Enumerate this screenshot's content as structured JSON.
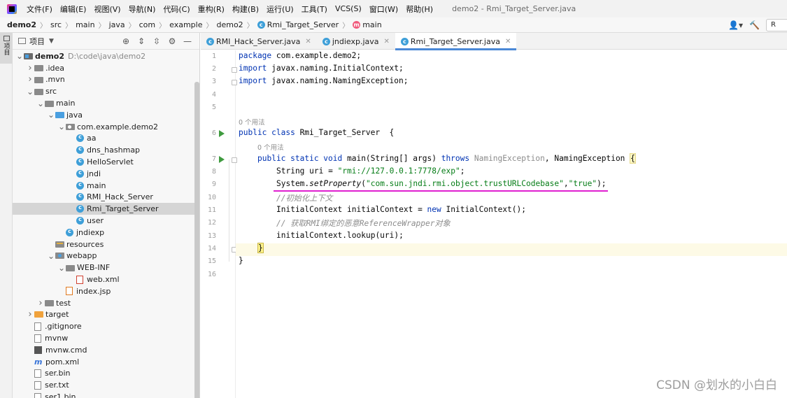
{
  "menu": {
    "items": [
      "文件(F)",
      "编辑(E)",
      "视图(V)",
      "导航(N)",
      "代码(C)",
      "重构(R)",
      "构建(B)",
      "运行(U)",
      "工具(T)",
      "VCS(S)",
      "窗口(W)",
      "帮助(H)"
    ],
    "window_title": "demo2 - Rmi_Target_Server.java"
  },
  "breadcrumb": {
    "items": [
      "demo2",
      "src",
      "main",
      "java",
      "com",
      "example",
      "demo2",
      "Rmi_Target_Server",
      "main"
    ],
    "run_config": "R"
  },
  "left_strip": {
    "label": "项目"
  },
  "project_panel": {
    "title": "项目",
    "tree": [
      {
        "label": "demo2",
        "extra": "D:\\code\\java\\demo2",
        "depth": 0,
        "arrow": "open",
        "icon": "module",
        "bold": true
      },
      {
        "label": ".idea",
        "depth": 1,
        "arrow": "closed",
        "icon": "folder"
      },
      {
        "label": ".mvn",
        "depth": 1,
        "arrow": "closed",
        "icon": "folder"
      },
      {
        "label": "src",
        "depth": 1,
        "arrow": "open",
        "icon": "folder"
      },
      {
        "label": "main",
        "depth": 2,
        "arrow": "open",
        "icon": "folder"
      },
      {
        "label": "java",
        "depth": 3,
        "arrow": "open",
        "icon": "folder-blue"
      },
      {
        "label": "com.example.demo2",
        "depth": 4,
        "arrow": "open",
        "icon": "folder-pkg"
      },
      {
        "label": "aa",
        "depth": 5,
        "arrow": "none",
        "icon": "javacls"
      },
      {
        "label": "dns_hashmap",
        "depth": 5,
        "arrow": "none",
        "icon": "javacls"
      },
      {
        "label": "HelloServlet",
        "depth": 5,
        "arrow": "none",
        "icon": "javacls"
      },
      {
        "label": "jndi",
        "depth": 5,
        "arrow": "none",
        "icon": "javacls"
      },
      {
        "label": "main",
        "depth": 5,
        "arrow": "none",
        "icon": "javacls"
      },
      {
        "label": "RMI_Hack_Server",
        "depth": 5,
        "arrow": "none",
        "icon": "javacls"
      },
      {
        "label": "Rmi_Target_Server",
        "depth": 5,
        "arrow": "none",
        "icon": "javacls",
        "selected": true
      },
      {
        "label": "user",
        "depth": 5,
        "arrow": "none",
        "icon": "javacls"
      },
      {
        "label": "jndiexp",
        "depth": 4,
        "arrow": "none",
        "icon": "javacls"
      },
      {
        "label": "resources",
        "depth": 3,
        "arrow": "none",
        "icon": "folder-res"
      },
      {
        "label": "webapp",
        "depth": 3,
        "arrow": "open",
        "icon": "folder-web"
      },
      {
        "label": "WEB-INF",
        "depth": 4,
        "arrow": "open",
        "icon": "folder"
      },
      {
        "label": "web.xml",
        "depth": 5,
        "arrow": "none",
        "icon": "xml"
      },
      {
        "label": "index.jsp",
        "depth": 4,
        "arrow": "none",
        "icon": "jsp"
      },
      {
        "label": "test",
        "depth": 2,
        "arrow": "closed",
        "icon": "folder"
      },
      {
        "label": "target",
        "depth": 1,
        "arrow": "closed",
        "icon": "folder-orange"
      },
      {
        "label": ".gitignore",
        "depth": 1,
        "arrow": "none",
        "icon": "file"
      },
      {
        "label": "mvnw",
        "depth": 1,
        "arrow": "none",
        "icon": "file"
      },
      {
        "label": "mvnw.cmd",
        "depth": 1,
        "arrow": "none",
        "icon": "cmd"
      },
      {
        "label": "pom.xml",
        "depth": 1,
        "arrow": "none",
        "icon": "maven"
      },
      {
        "label": "ser.bin",
        "depth": 1,
        "arrow": "none",
        "icon": "file"
      },
      {
        "label": "ser.txt",
        "depth": 1,
        "arrow": "none",
        "icon": "file"
      },
      {
        "label": "ser1.bin",
        "depth": 1,
        "arrow": "none",
        "icon": "file"
      }
    ]
  },
  "tabs": [
    {
      "label": "RMI_Hack_Server.java",
      "active": false
    },
    {
      "label": "jndiexp.java",
      "active": false
    },
    {
      "label": "Rmi_Target_Server.java",
      "active": true
    }
  ],
  "editor": {
    "line_numbers": [
      "1",
      "2",
      "3",
      "4",
      "5",
      "6",
      "7",
      "8",
      "9",
      "10",
      "11",
      "12",
      "13",
      "14",
      "15",
      "16"
    ],
    "usage_hint_class": "0 个用法",
    "usage_hint_method": "0 个用法",
    "code": {
      "l1_kw": "package",
      "l1_rest": " com.example.demo2;",
      "l2_kw": "import",
      "l2_rest": " javax.naming.InitialContext;",
      "l3_kw": "import",
      "l3_rest": " javax.naming.NamingException;",
      "l6_kw": "public class",
      "l6_rest": " Rmi_Target_Server  {",
      "l7_kw": "public static void",
      "l7_mid": " main(String[] args) ",
      "l7_throws": "throws",
      "l7_gray": " NamingException",
      "l7_rest": ", NamingException ",
      "l7_brace": "{",
      "l8_pre": "String uri = ",
      "l8_str": "\"rmi://127.0.0.1:7778/exp\"",
      "l8_post": ";",
      "l9_pre": "System.",
      "l9_ital": "setProperty",
      "l9_open": "(",
      "l9_str1": "\"com.sun.jndi.rmi.object.trustURLCodebase\"",
      "l9_comma": ",",
      "l9_str2": "\"true\"",
      "l9_post": ");",
      "l10_cmt": "//初始化上下文",
      "l11_pre": "InitialContext initialContext = ",
      "l11_kw": "new",
      "l11_post": " InitialContext();",
      "l12_cmt": "// 获取RMI绑定的恶意ReferenceWrapper对象",
      "l13": "initialContext.lookup(uri);",
      "l14_brace": "}",
      "l15": "}"
    }
  },
  "watermark": "CSDN @划水的小白白"
}
